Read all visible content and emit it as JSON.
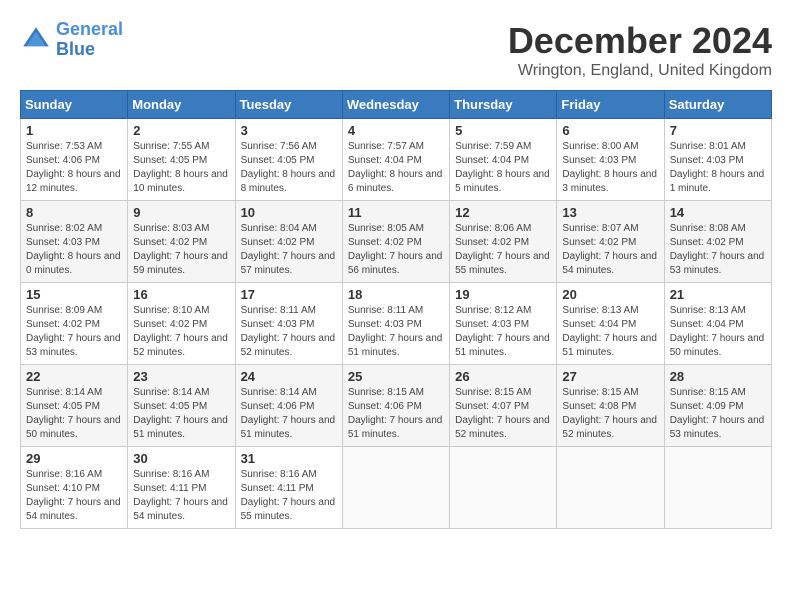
{
  "logo": {
    "line1": "General",
    "line2": "Blue"
  },
  "title": "December 2024",
  "subtitle": "Wrington, England, United Kingdom",
  "days_of_week": [
    "Sunday",
    "Monday",
    "Tuesday",
    "Wednesday",
    "Thursday",
    "Friday",
    "Saturday"
  ],
  "weeks": [
    [
      {
        "day": "1",
        "sunrise": "7:53 AM",
        "sunset": "4:06 PM",
        "daylight": "8 hours and 12 minutes."
      },
      {
        "day": "2",
        "sunrise": "7:55 AM",
        "sunset": "4:05 PM",
        "daylight": "8 hours and 10 minutes."
      },
      {
        "day": "3",
        "sunrise": "7:56 AM",
        "sunset": "4:05 PM",
        "daylight": "8 hours and 8 minutes."
      },
      {
        "day": "4",
        "sunrise": "7:57 AM",
        "sunset": "4:04 PM",
        "daylight": "8 hours and 6 minutes."
      },
      {
        "day": "5",
        "sunrise": "7:59 AM",
        "sunset": "4:04 PM",
        "daylight": "8 hours and 5 minutes."
      },
      {
        "day": "6",
        "sunrise": "8:00 AM",
        "sunset": "4:03 PM",
        "daylight": "8 hours and 3 minutes."
      },
      {
        "day": "7",
        "sunrise": "8:01 AM",
        "sunset": "4:03 PM",
        "daylight": "8 hours and 1 minute."
      }
    ],
    [
      {
        "day": "8",
        "sunrise": "8:02 AM",
        "sunset": "4:03 PM",
        "daylight": "8 hours and 0 minutes."
      },
      {
        "day": "9",
        "sunrise": "8:03 AM",
        "sunset": "4:02 PM",
        "daylight": "7 hours and 59 minutes."
      },
      {
        "day": "10",
        "sunrise": "8:04 AM",
        "sunset": "4:02 PM",
        "daylight": "7 hours and 57 minutes."
      },
      {
        "day": "11",
        "sunrise": "8:05 AM",
        "sunset": "4:02 PM",
        "daylight": "7 hours and 56 minutes."
      },
      {
        "day": "12",
        "sunrise": "8:06 AM",
        "sunset": "4:02 PM",
        "daylight": "7 hours and 55 minutes."
      },
      {
        "day": "13",
        "sunrise": "8:07 AM",
        "sunset": "4:02 PM",
        "daylight": "7 hours and 54 minutes."
      },
      {
        "day": "14",
        "sunrise": "8:08 AM",
        "sunset": "4:02 PM",
        "daylight": "7 hours and 53 minutes."
      }
    ],
    [
      {
        "day": "15",
        "sunrise": "8:09 AM",
        "sunset": "4:02 PM",
        "daylight": "7 hours and 53 minutes."
      },
      {
        "day": "16",
        "sunrise": "8:10 AM",
        "sunset": "4:02 PM",
        "daylight": "7 hours and 52 minutes."
      },
      {
        "day": "17",
        "sunrise": "8:11 AM",
        "sunset": "4:03 PM",
        "daylight": "7 hours and 52 minutes."
      },
      {
        "day": "18",
        "sunrise": "8:11 AM",
        "sunset": "4:03 PM",
        "daylight": "7 hours and 51 minutes."
      },
      {
        "day": "19",
        "sunrise": "8:12 AM",
        "sunset": "4:03 PM",
        "daylight": "7 hours and 51 minutes."
      },
      {
        "day": "20",
        "sunrise": "8:13 AM",
        "sunset": "4:04 PM",
        "daylight": "7 hours and 51 minutes."
      },
      {
        "day": "21",
        "sunrise": "8:13 AM",
        "sunset": "4:04 PM",
        "daylight": "7 hours and 50 minutes."
      }
    ],
    [
      {
        "day": "22",
        "sunrise": "8:14 AM",
        "sunset": "4:05 PM",
        "daylight": "7 hours and 50 minutes."
      },
      {
        "day": "23",
        "sunrise": "8:14 AM",
        "sunset": "4:05 PM",
        "daylight": "7 hours and 51 minutes."
      },
      {
        "day": "24",
        "sunrise": "8:14 AM",
        "sunset": "4:06 PM",
        "daylight": "7 hours and 51 minutes."
      },
      {
        "day": "25",
        "sunrise": "8:15 AM",
        "sunset": "4:06 PM",
        "daylight": "7 hours and 51 minutes."
      },
      {
        "day": "26",
        "sunrise": "8:15 AM",
        "sunset": "4:07 PM",
        "daylight": "7 hours and 52 minutes."
      },
      {
        "day": "27",
        "sunrise": "8:15 AM",
        "sunset": "4:08 PM",
        "daylight": "7 hours and 52 minutes."
      },
      {
        "day": "28",
        "sunrise": "8:15 AM",
        "sunset": "4:09 PM",
        "daylight": "7 hours and 53 minutes."
      }
    ],
    [
      {
        "day": "29",
        "sunrise": "8:16 AM",
        "sunset": "4:10 PM",
        "daylight": "7 hours and 54 minutes."
      },
      {
        "day": "30",
        "sunrise": "8:16 AM",
        "sunset": "4:11 PM",
        "daylight": "7 hours and 54 minutes."
      },
      {
        "day": "31",
        "sunrise": "8:16 AM",
        "sunset": "4:11 PM",
        "daylight": "7 hours and 55 minutes."
      },
      null,
      null,
      null,
      null
    ]
  ]
}
